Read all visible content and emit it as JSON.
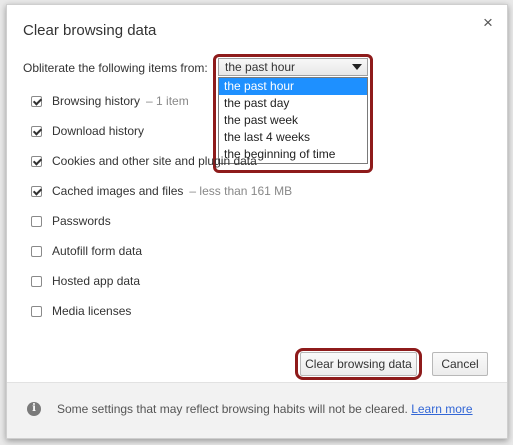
{
  "dialog": {
    "title": "Clear browsing data",
    "close_symbol": "×"
  },
  "time_range": {
    "label": "Obliterate the following items from:",
    "selected": "the past hour",
    "options": [
      "the past hour",
      "the past day",
      "the past week",
      "the last 4 weeks",
      "the beginning of time"
    ]
  },
  "items": [
    {
      "label": "Browsing history",
      "detail": "– 1 item",
      "checked": true
    },
    {
      "label": "Download history",
      "detail": "",
      "checked": true
    },
    {
      "label": "Cookies and other site and plugin data",
      "detail": "",
      "checked": true
    },
    {
      "label": "Cached images and files",
      "detail": "– less than 161 MB",
      "checked": true
    },
    {
      "label": "Passwords",
      "detail": "",
      "checked": false
    },
    {
      "label": "Autofill form data",
      "detail": "",
      "checked": false
    },
    {
      "label": "Hosted app data",
      "detail": "",
      "checked": false
    },
    {
      "label": "Media licenses",
      "detail": "",
      "checked": false
    }
  ],
  "buttons": {
    "clear": "Clear browsing data",
    "cancel": "Cancel"
  },
  "footer": {
    "info_icon": "info-icon",
    "text": "Some settings that may reflect browsing habits will not be cleared.",
    "link": "Learn more"
  },
  "colors": {
    "highlight": "#8e1b1b",
    "selection": "#1e90ff",
    "link": "#3367d6"
  }
}
